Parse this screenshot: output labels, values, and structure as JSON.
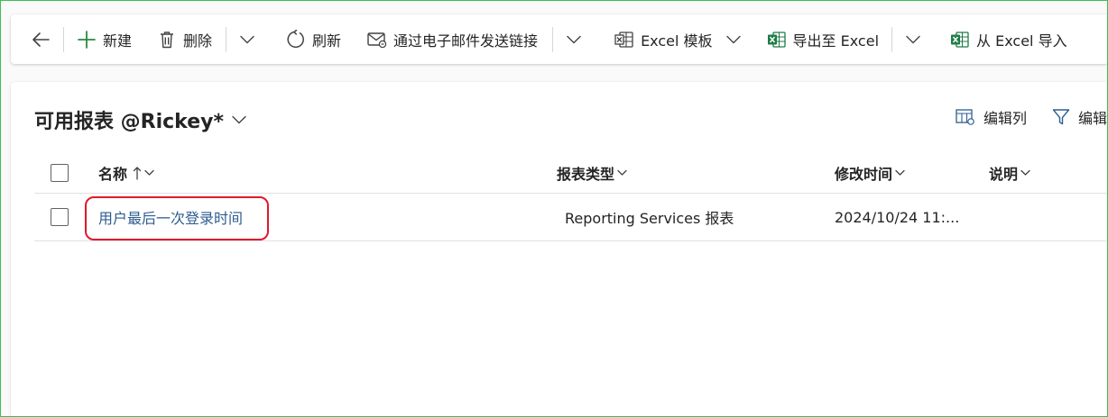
{
  "toolbar": {
    "back_label": "",
    "new_label": "新建",
    "delete_label": "删除",
    "refresh_label": "刷新",
    "email_link_label": "通过电子邮件发送链接",
    "excel_template_label": "Excel 模板",
    "export_excel_label": "导出至 Excel",
    "import_excel_label": "从 Excel 导入"
  },
  "view": {
    "title": "可用报表 @Rickey*",
    "edit_columns_label": "编辑列",
    "filter_label": "编辑"
  },
  "grid": {
    "columns": {
      "name": "名称",
      "report_type": "报表类型",
      "modified_on": "修改时间",
      "description": "说明"
    },
    "rows": [
      {
        "name": "用户最后一次登录时间",
        "report_type": "Reporting Services 报表",
        "modified_on": "2024/10/24 11:...",
        "description": ""
      }
    ]
  },
  "colors": {
    "accent_link": "#2d5d8f",
    "excel_green": "#1e7b45",
    "annotation_red": "#e0192b",
    "new_plus_green": "#2a8a3e"
  },
  "icons": [
    "back-arrow-icon",
    "plus-icon",
    "trash-icon",
    "refresh-icon",
    "email-link-icon",
    "excel-icon",
    "chevron-down-icon",
    "edit-columns-icon",
    "filter-icon",
    "sort-ascending-icon"
  ]
}
